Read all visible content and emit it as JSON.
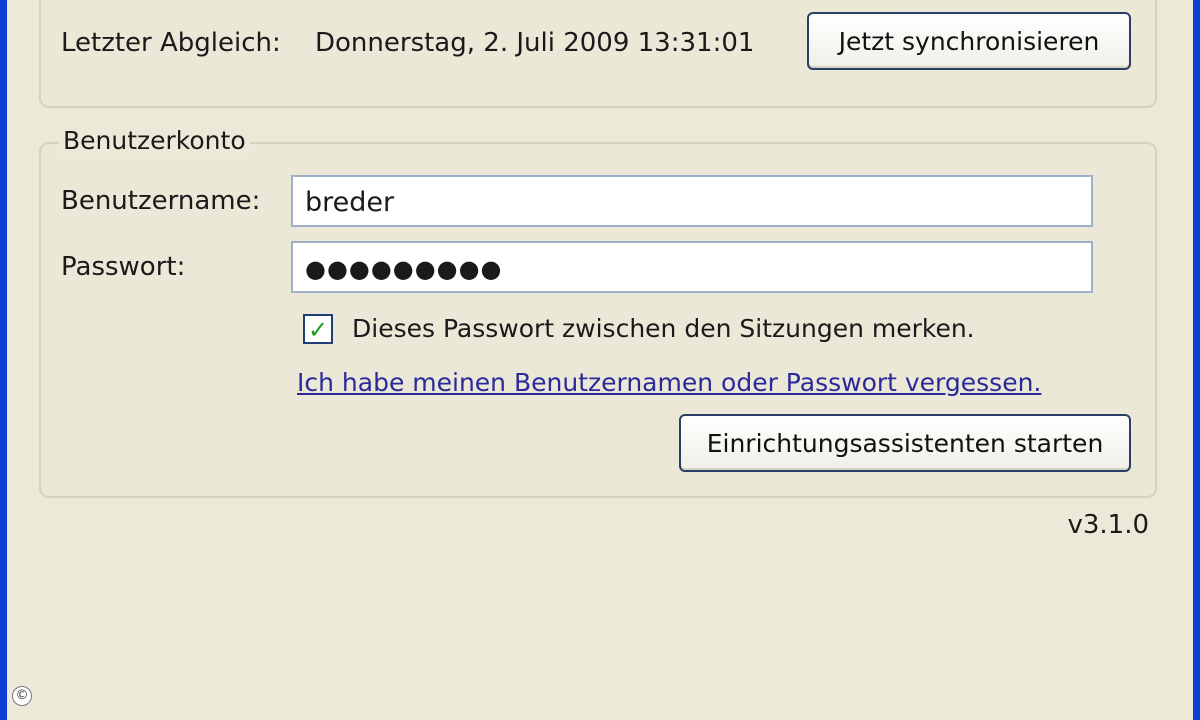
{
  "sync": {
    "last_sync_label": "Letzter Abgleich:",
    "last_sync_value": "Donnerstag, 2. Juli 2009 13:31:01",
    "sync_now_button": "Jetzt synchronisieren"
  },
  "account": {
    "legend": "Benutzerkonto",
    "username_label": "Benutzername:",
    "username_value": "breder",
    "password_label": "Passwort:",
    "password_value": "●●●●●●●●●",
    "remember_password_label": "Dieses Passwort zwischen den Sitzungen merken.",
    "remember_password_checked": true,
    "forgot_link": "Ich habe meinen Benutzernamen oder Passwort vergessen.",
    "wizard_button": "Einrichtungsassistenten starten"
  },
  "footer": {
    "version": "v3.1.0",
    "copyright_symbol": "©"
  },
  "colors": {
    "window_background": "#ece9d8",
    "frame_blue": "#0a3fd6",
    "link_color": "#2a2a9b",
    "check_green": "#1a9a21"
  }
}
